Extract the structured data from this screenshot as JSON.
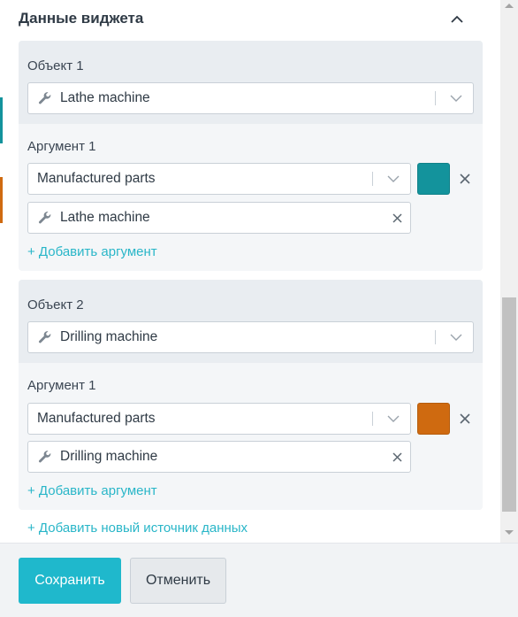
{
  "header": {
    "title": "Данные виджета"
  },
  "colors": {
    "accent": "#1fb8cc",
    "teal": "#13939c",
    "orange": "#cf6a10"
  },
  "sources": [
    {
      "object_label": "Объект 1",
      "object_value": "Lathe machine",
      "argument_label": "Аргумент 1",
      "argument_value": "Manufactured parts",
      "argument_object": "Lathe machine",
      "add_argument": "+ Добавить аргумент"
    },
    {
      "object_label": "Объект 2",
      "object_value": "Drilling machine",
      "argument_label": "Аргумент 1",
      "argument_value": "Manufactured parts",
      "argument_object": "Drilling machine",
      "add_argument": "+ Добавить аргумент"
    }
  ],
  "add_source": "+ Добавить новый источник данных",
  "footer": {
    "save": "Сохранить",
    "cancel": "Отменить"
  }
}
